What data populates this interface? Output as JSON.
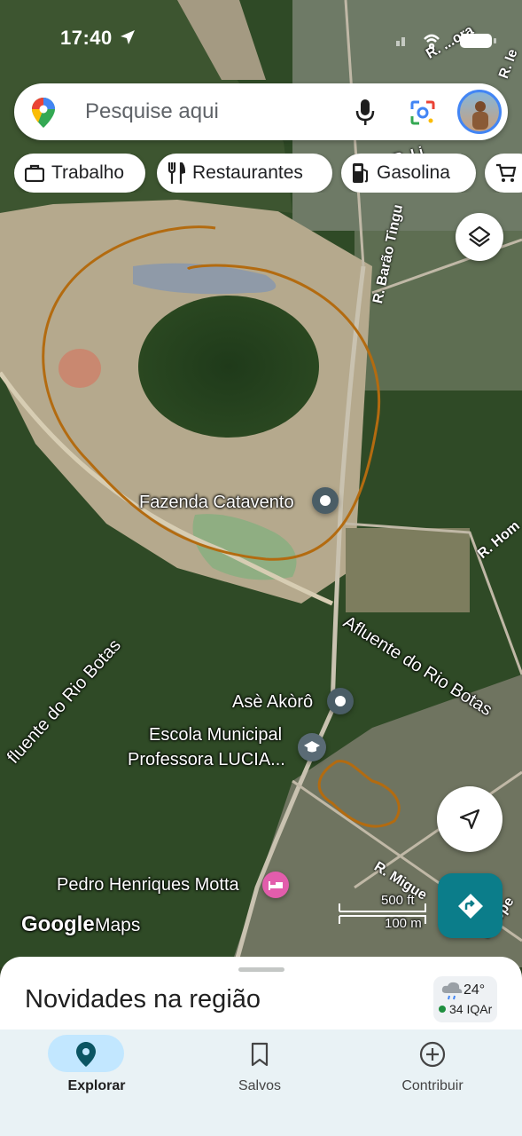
{
  "status_bar": {
    "time": "17:40"
  },
  "search": {
    "placeholder": "Pesquise aqui",
    "icons": [
      "google-maps-pin-icon",
      "mic-icon",
      "lens-icon",
      "avatar"
    ]
  },
  "chips": [
    {
      "label": "Trabalho",
      "icon": "briefcase-icon"
    },
    {
      "label": "Restaurantes",
      "icon": "fork-knife-icon"
    },
    {
      "label": "Gasolina",
      "icon": "gas-station-icon"
    },
    {
      "label": "",
      "icon": "cart-icon"
    }
  ],
  "map": {
    "places": {
      "fazenda": "Fazenda Catavento",
      "ase": "Asè Akòrô",
      "escola_line1": "Escola Municipal",
      "escola_line2": "Professora LUCIA...",
      "pedro": "Pedro Henriques Motta"
    },
    "roads": {
      "barao": "R. Barão Tingu",
      "li": "R. Li",
      "hom": "R. Hom",
      "miguel": "R. Migue",
      "lopes": "a Lope",
      "top1": "R. ...ora",
      "top2": "R. Ie"
    },
    "rivers": {
      "right": "Afluente do Rio Botas",
      "left": "fluente do Rio Botas"
    },
    "scale": {
      "feet": "500 ft",
      "meters": "100 m"
    },
    "brand": {
      "google": "Google",
      "maps": "Maps"
    }
  },
  "sheet": {
    "title": "Novidades na região",
    "weather": {
      "temp": "24°",
      "aqi": "34 IQAr"
    }
  },
  "bottom_nav": [
    {
      "label": "Explorar",
      "icon": "explore-pin-icon",
      "active": true
    },
    {
      "label": "Salvos",
      "icon": "bookmark-icon",
      "active": false
    },
    {
      "label": "Contribuir",
      "icon": "add-circle-icon",
      "active": false
    }
  ],
  "colors": {
    "accent": "#0b7d8a",
    "annotation": "#b36b10",
    "nav_bg": "#e9f2f5",
    "active_pill": "#c2e7ff"
  }
}
